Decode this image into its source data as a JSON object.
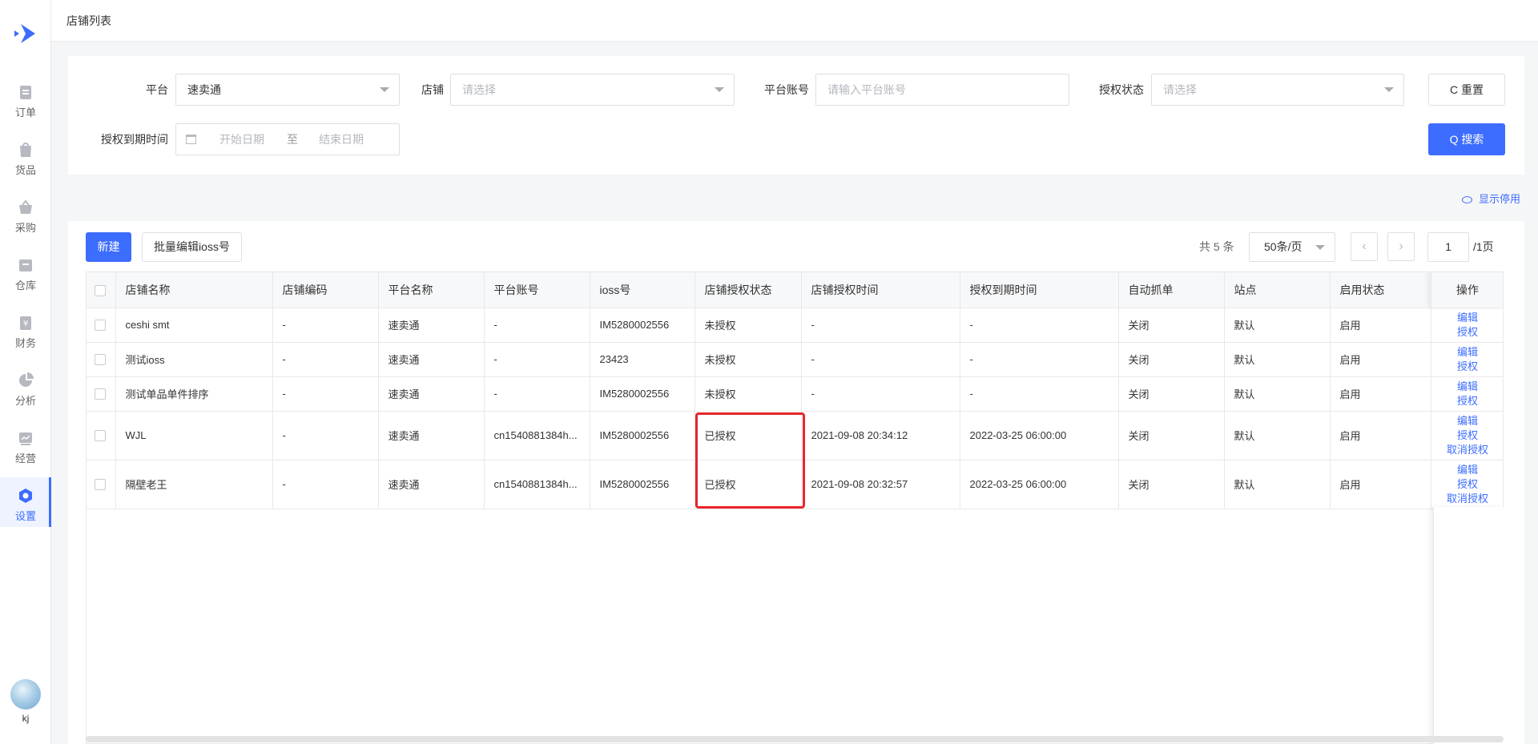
{
  "sidebar": {
    "items": [
      {
        "label": "订单",
        "icon": "order-icon"
      },
      {
        "label": "货品",
        "icon": "goods-icon"
      },
      {
        "label": "采购",
        "icon": "purchase-icon"
      },
      {
        "label": "仓库",
        "icon": "warehouse-icon"
      },
      {
        "label": "财务",
        "icon": "finance-icon"
      },
      {
        "label": "分析",
        "icon": "analysis-icon"
      },
      {
        "label": "经营",
        "icon": "operation-icon"
      },
      {
        "label": "设置",
        "icon": "settings-icon",
        "active": true
      }
    ],
    "user": "kj",
    "accent": "#3d6dfe"
  },
  "header": {
    "title": "店铺列表"
  },
  "filters": {
    "platform_label": "平台",
    "platform_value": "速卖通",
    "store_label": "店铺",
    "store_placeholder": "请选择",
    "account_label": "平台账号",
    "account_placeholder": "请输入平台账号",
    "auth_status_label": "授权状态",
    "auth_status_placeholder": "请选择",
    "expire_label": "授权到期时间",
    "start_placeholder": "开始日期",
    "range_sep": "至",
    "end_placeholder": "结束日期",
    "reset_label": "C 重置",
    "search_label": "Q 搜索"
  },
  "show_disabled": "显示停用",
  "toolbar": {
    "new_label": "新建",
    "bulk_label": "批量编辑ioss号",
    "total": "共 5 条",
    "page_size": "50条/页",
    "page": "1",
    "page_total": "/1页"
  },
  "table": {
    "columns": [
      "店铺名称",
      "店铺编码",
      "平台名称",
      "平台账号",
      "ioss号",
      "店铺授权状态",
      "店铺授权时间",
      "授权到期时间",
      "自动抓单",
      "站点",
      "启用状态",
      "操作"
    ],
    "rows": [
      {
        "name": "ceshi smt",
        "code": "-",
        "platform": "速卖通",
        "account": "-",
        "ioss": "IM5280002556",
        "auth": "未授权",
        "auth_time": "-",
        "expire": "-",
        "auto": "关闭",
        "site": "默认",
        "enabled": "启用",
        "ops": [
          "编辑",
          "授权"
        ]
      },
      {
        "name": "测试ioss",
        "code": "-",
        "platform": "速卖通",
        "account": "-",
        "ioss": "23423",
        "auth": "未授权",
        "auth_time": "-",
        "expire": "-",
        "auto": "关闭",
        "site": "默认",
        "enabled": "启用",
        "ops": [
          "编辑",
          "授权"
        ]
      },
      {
        "name": "测试单品单件排序",
        "code": "-",
        "platform": "速卖通",
        "account": "-",
        "ioss": "IM5280002556",
        "auth": "未授权",
        "auth_time": "-",
        "expire": "-",
        "auto": "关闭",
        "site": "默认",
        "enabled": "启用",
        "ops": [
          "编辑",
          "授权"
        ]
      },
      {
        "name": "WJL",
        "code": "-",
        "platform": "速卖通",
        "account": "cn1540881384h...",
        "ioss": "IM5280002556",
        "auth": "已授权",
        "auth_time": "2021-09-08 20:34:12",
        "expire": "2022-03-25 06:00:00",
        "auto": "关闭",
        "site": "默认",
        "enabled": "启用",
        "ops": [
          "编辑",
          "授权",
          "取消授权"
        ]
      },
      {
        "name": "隔壁老王",
        "code": "-",
        "platform": "速卖通",
        "account": "cn1540881384h...",
        "ioss": "IM5280002556",
        "auth": "已授权",
        "auth_time": "2021-09-08 20:32:57",
        "expire": "2022-03-25 06:00:00",
        "auto": "关闭",
        "site": "默认",
        "enabled": "启用",
        "ops": [
          "编辑",
          "授权",
          "取消授权"
        ]
      }
    ]
  }
}
